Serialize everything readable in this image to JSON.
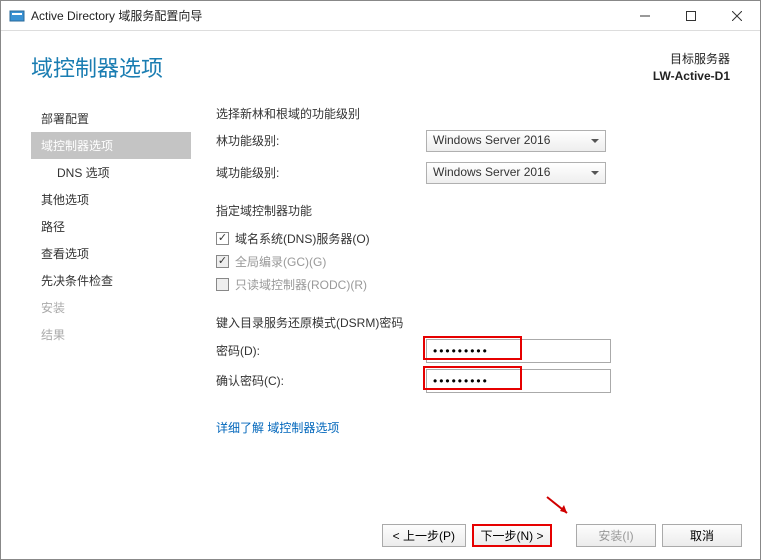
{
  "window": {
    "title": "Active Directory 域服务配置向导"
  },
  "header": {
    "title": "域控制器选项",
    "target_label": "目标服务器",
    "target_server": "LW-Active-D1"
  },
  "sidebar": {
    "items": [
      {
        "label": "部署配置",
        "active": false,
        "sub": false,
        "disabled": false
      },
      {
        "label": "域控制器选项",
        "active": true,
        "sub": false,
        "disabled": false
      },
      {
        "label": "DNS 选项",
        "active": false,
        "sub": true,
        "disabled": false
      },
      {
        "label": "其他选项",
        "active": false,
        "sub": false,
        "disabled": false
      },
      {
        "label": "路径",
        "active": false,
        "sub": false,
        "disabled": false
      },
      {
        "label": "查看选项",
        "active": false,
        "sub": false,
        "disabled": false
      },
      {
        "label": "先决条件检查",
        "active": false,
        "sub": false,
        "disabled": false
      },
      {
        "label": "安装",
        "active": false,
        "sub": false,
        "disabled": true
      },
      {
        "label": "结果",
        "active": false,
        "sub": false,
        "disabled": true
      }
    ]
  },
  "main": {
    "func_level_title": "选择新林和根域的功能级别",
    "forest_label": "林功能级别:",
    "domain_label": "域功能级别:",
    "forest_value": "Windows Server 2016",
    "domain_value": "Windows Server 2016",
    "cap_title": "指定域控制器功能",
    "cb_dns": "域名系统(DNS)服务器(O)",
    "cb_gc": "全局编录(GC)(G)",
    "cb_rodc": "只读域控制器(RODC)(R)",
    "dsrm_title": "键入目录服务还原模式(DSRM)密码",
    "pwd_label": "密码(D):",
    "confirm_label": "确认密码(C):",
    "pwd_value": "●●●●●●●●●",
    "confirm_value": "●●●●●●●●●",
    "link": "详细了解 域控制器选项"
  },
  "buttons": {
    "prev": "< 上一步(P)",
    "next": "下一步(N) >",
    "install": "安装(I)",
    "cancel": "取消"
  }
}
